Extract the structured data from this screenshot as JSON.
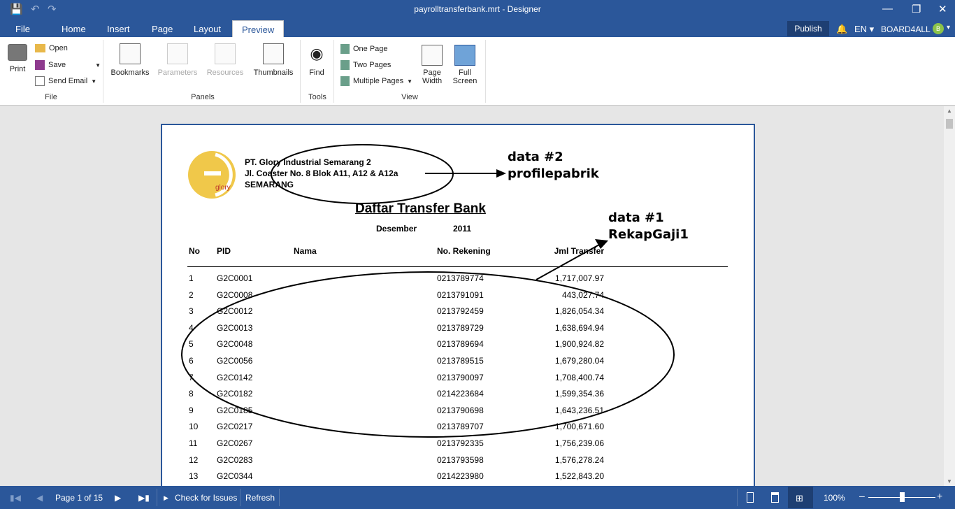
{
  "window": {
    "title": "payrolltransferbank.mrt - Designer"
  },
  "tabs": [
    {
      "label": "File"
    },
    {
      "label": "Home"
    },
    {
      "label": "Insert"
    },
    {
      "label": "Page"
    },
    {
      "label": "Layout"
    },
    {
      "label": "Preview"
    }
  ],
  "header_right": {
    "publish": "Publish",
    "language": "EN",
    "user": "BOARD4ALL",
    "avatar": "B"
  },
  "ribbon": {
    "file": {
      "print": "Print",
      "open": "Open",
      "save": "Save",
      "send_email": "Send Email",
      "label": "File"
    },
    "panels": {
      "bookmarks": "Bookmarks",
      "parameters": "Parameters",
      "resources": "Resources",
      "thumbnails": "Thumbnails",
      "label": "Panels"
    },
    "tools": {
      "find": "Find",
      "label": "Tools"
    },
    "view": {
      "one_page": "One Page",
      "two_pages": "Two Pages",
      "multiple_pages": "Multiple Pages",
      "page_width_1": "Page",
      "page_width_2": "Width",
      "full_screen_1": "Full",
      "full_screen_2": "Screen",
      "label": "View"
    }
  },
  "report": {
    "company": [
      "PT. Glory Industrial Semarang 2",
      "Jl. Coaster No. 8 Blok A11, A12 & A12a",
      "SEMARANG"
    ],
    "logo_text": "glory",
    "title": "Daftar Transfer Bank",
    "month": "Desember",
    "year": "2011",
    "columns": [
      "No",
      "PID",
      "Nama",
      "No. Rekening",
      "Jml Transfer"
    ],
    "rows": [
      [
        "1",
        "G2C0001",
        "",
        "0213789774",
        "1,717,007.97"
      ],
      [
        "2",
        "G2C0008",
        "",
        "0213791091",
        "443,027.74"
      ],
      [
        "3",
        "G2C0012",
        "",
        "0213792459",
        "1,826,054.34"
      ],
      [
        "4",
        "G2C0013",
        "",
        "0213789729",
        "1,638,694.94"
      ],
      [
        "5",
        "G2C0048",
        "",
        "0213789694",
        "1,900,924.82"
      ],
      [
        "6",
        "G2C0056",
        "",
        "0213789515",
        "1,679,280.04"
      ],
      [
        "7",
        "G2C0142",
        "",
        "0213790097",
        "1,708,400.74"
      ],
      [
        "8",
        "G2C0182",
        "",
        "0214223684",
        "1,599,354.36"
      ],
      [
        "9",
        "G2C0185",
        "",
        "0213790698",
        "1,643,236.51"
      ],
      [
        "10",
        "G2C0217",
        "",
        "0213789707",
        "1,700,671.60"
      ],
      [
        "11",
        "G2C0267",
        "",
        "0213792335",
        "1,756,239.06"
      ],
      [
        "12",
        "G2C0283",
        "",
        "0213793598",
        "1,576,278.24"
      ],
      [
        "13",
        "G2C0344",
        "",
        "0214223980",
        "1,522,843.20"
      ]
    ]
  },
  "annotations": {
    "a2_line1": "data #2",
    "a2_line2": "profilepabrik",
    "a1_line1": "data #1",
    "a1_line2": "RekapGaji1"
  },
  "statusbar": {
    "page": "Page 1 of 15",
    "check": "Check for Issues",
    "refresh": "Refresh",
    "zoom": "100%",
    "zoom_value": 100
  },
  "colors": {
    "accent": "#2b579a",
    "logo": "#f0c84a"
  }
}
